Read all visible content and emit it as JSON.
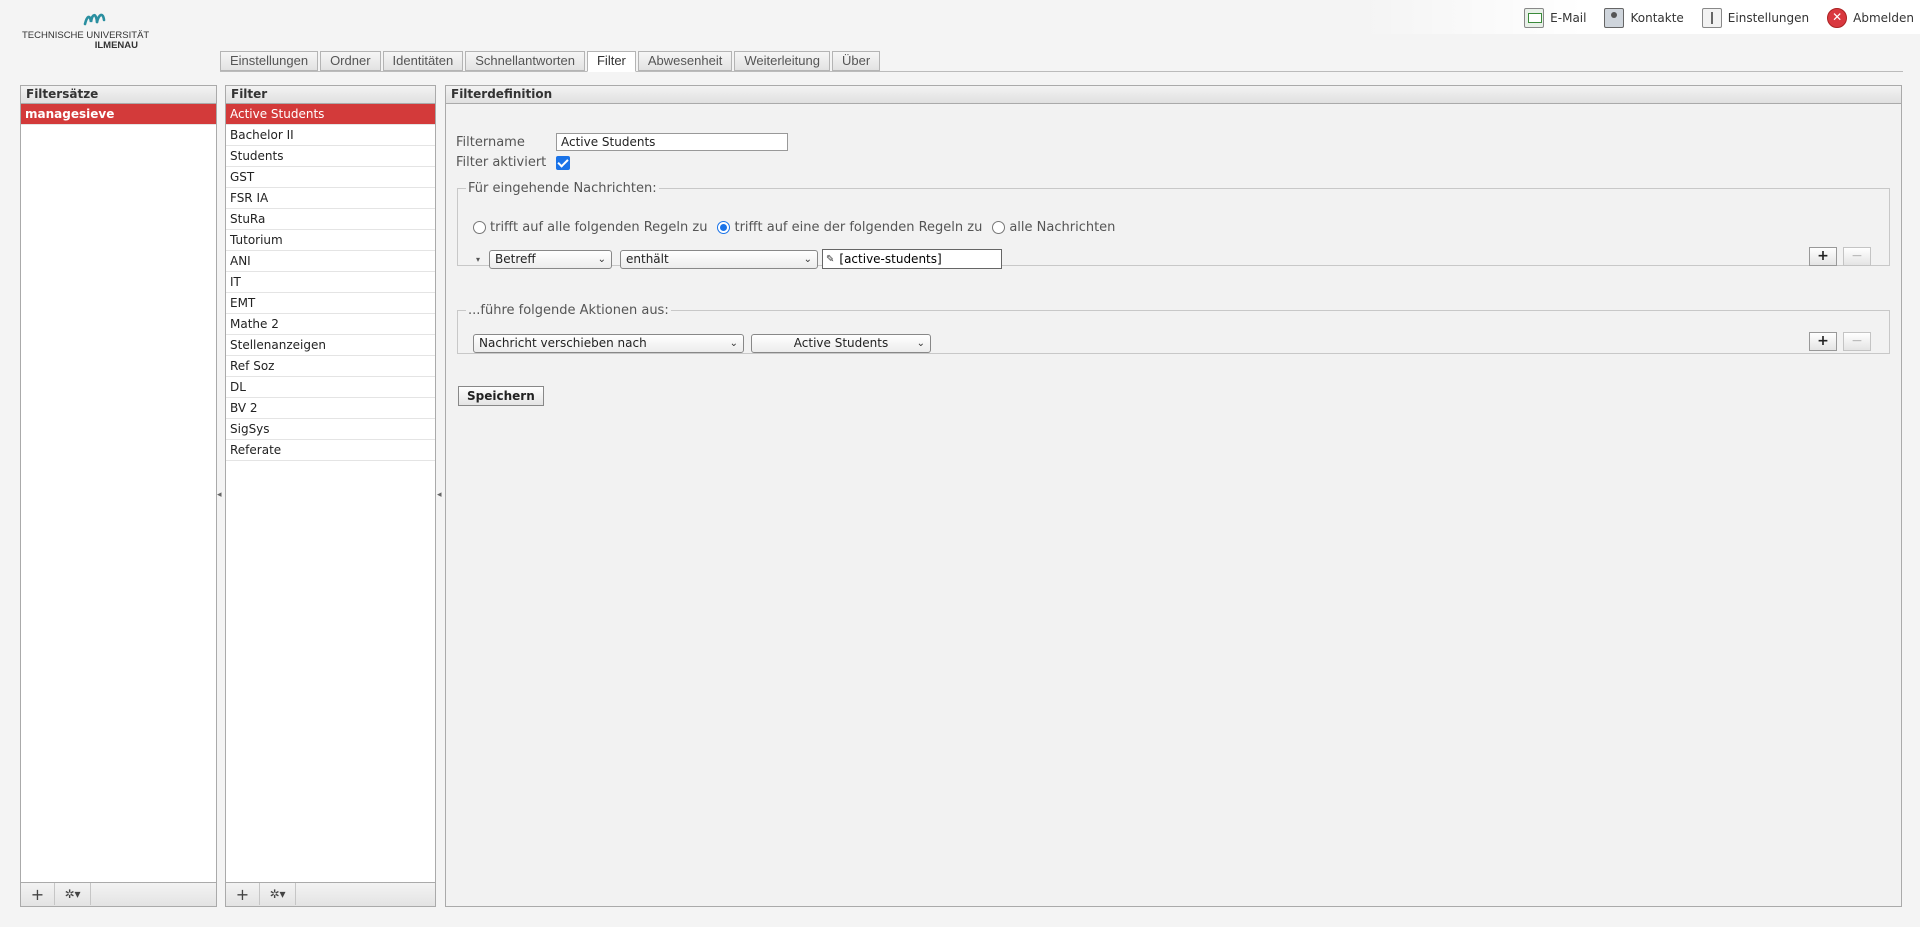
{
  "logo": {
    "line1": "TECHNISCHE UNIVERSITÄT",
    "line2": "ILMENAU"
  },
  "topnav": {
    "links": [
      {
        "label": "E-Mail",
        "icon": "mail-icon"
      },
      {
        "label": "Kontakte",
        "icon": "contacts-icon"
      },
      {
        "label": "Einstellungen",
        "icon": "settings-icon"
      },
      {
        "label": "Abmelden",
        "icon": "logout-icon"
      }
    ]
  },
  "tabs": [
    {
      "label": "Einstellungen"
    },
    {
      "label": "Ordner"
    },
    {
      "label": "Identitäten"
    },
    {
      "label": "Schnellantworten"
    },
    {
      "label": "Filter",
      "active": true
    },
    {
      "label": "Abwesenheit"
    },
    {
      "label": "Weiterleitung"
    },
    {
      "label": "Über"
    }
  ],
  "filtersets": {
    "header": "Filtersätze",
    "items": [
      "managesieve"
    ],
    "selected": 0
  },
  "filters": {
    "header": "Filter",
    "items": [
      "Active Students",
      "Bachelor II",
      "Students",
      "GST",
      "FSR IA",
      "StuRa",
      "Tutorium",
      "ANI",
      "IT",
      "EMT",
      "Mathe 2",
      "Stellenanzeigen",
      "Ref Soz",
      "DL",
      "BV 2",
      "SigSys",
      "Referate"
    ],
    "selected": 0
  },
  "definition": {
    "header": "Filterdefinition",
    "name_label": "Filtername",
    "name_value": "Active Students",
    "enabled_label": "Filter aktiviert",
    "enabled": true,
    "incoming": {
      "legend": "Für eingehende Nachrichten:",
      "options": [
        "trifft auf alle folgenden Regeln zu",
        "trifft auf eine der folgenden Regeln zu",
        "alle Nachrichten"
      ],
      "selected": 1,
      "rule": {
        "header": "Betreff",
        "operator": "enthält",
        "value": "[active-students]"
      },
      "add": "+",
      "remove": "−"
    },
    "actions": {
      "legend": "...führe folgende Aktionen aus:",
      "action": "Nachricht verschieben nach",
      "target": "Active Students",
      "add": "+",
      "remove": "−"
    },
    "save_label": "Speichern"
  },
  "footer": {
    "add": "+",
    "gear": "✲▾"
  },
  "colors": {
    "accent": "#d33a3a",
    "checkbox": "#1a73e8"
  }
}
